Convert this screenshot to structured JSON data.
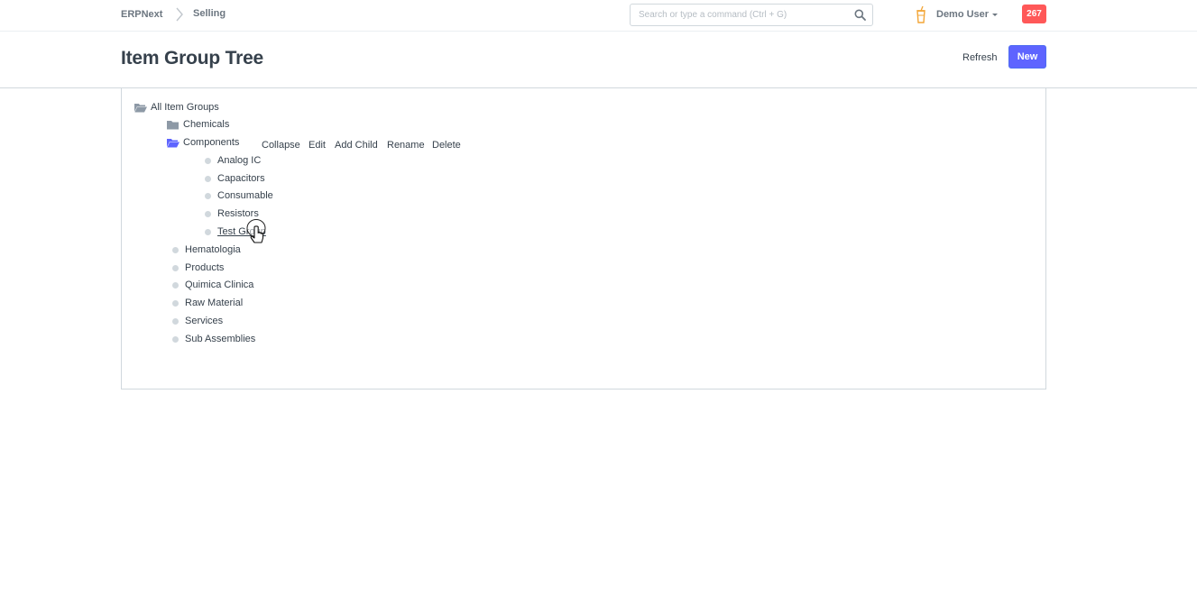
{
  "navbar": {
    "brand": "ERPNext",
    "breadcrumb": "Selling",
    "search_placeholder": "Search or type a command (Ctrl + G)",
    "user_name": "Demo User",
    "notification_count": "267"
  },
  "page": {
    "title": "Item Group Tree",
    "refresh_label": "Refresh",
    "new_label": "New"
  },
  "tree": {
    "root": "All Item Groups",
    "chemicals": "Chemicals",
    "components": "Components",
    "component_children": [
      "Analog IC",
      "Capacitors",
      "Consumable",
      "Resistors",
      "Test Group"
    ],
    "top_level_leaves": [
      "Hematologia",
      "Products",
      "Quimica Clinica",
      "Raw Material",
      "Services",
      "Sub Assemblies"
    ],
    "actions": [
      "Collapse",
      "Edit",
      "Add Child",
      "Rename",
      "Delete"
    ]
  },
  "colors": {
    "primary": "#5e64ff",
    "badge": "#ff5858",
    "folder_closed": "#8d99a6",
    "folder_open": "#5e64ff",
    "leaf_dot": "#d1d8dd"
  }
}
